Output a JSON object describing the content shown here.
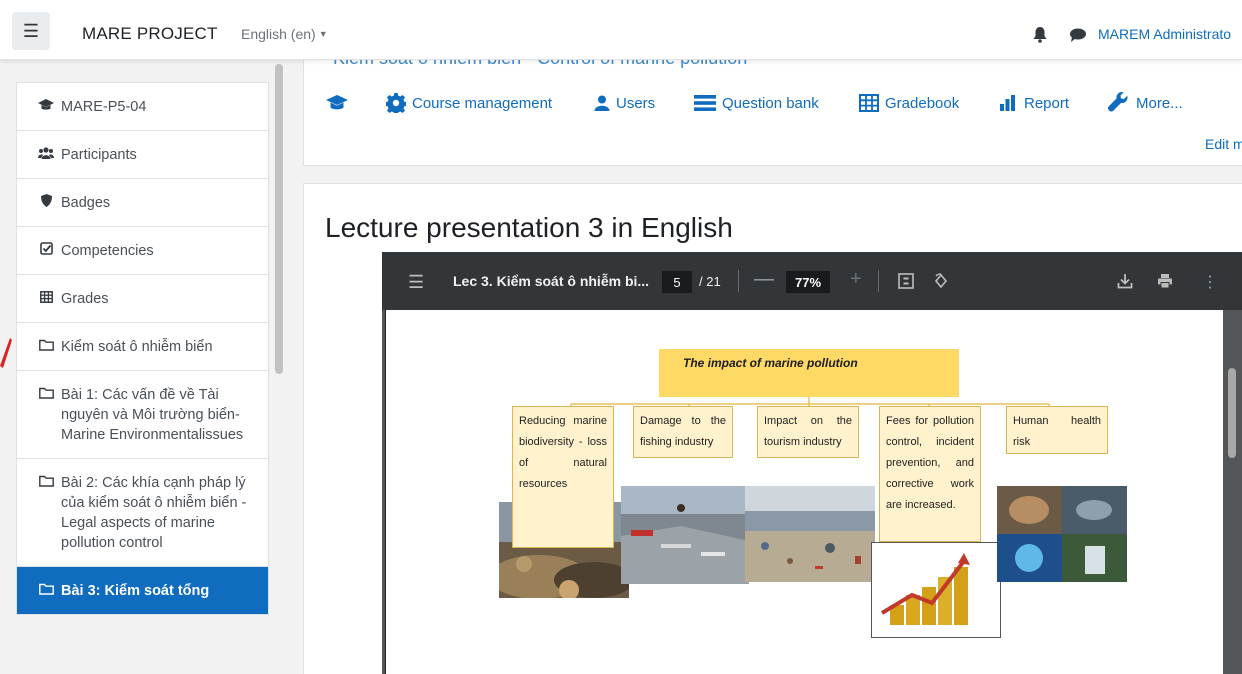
{
  "navbar": {
    "site_name": "MARE PROJECT",
    "language": "English (en)",
    "user_name": "MAREM Administrato"
  },
  "sidebar": {
    "items": [
      {
        "label": "MARE-P5-04",
        "icon": "graduation-cap-icon"
      },
      {
        "label": "Participants",
        "icon": "users-icon"
      },
      {
        "label": "Badges",
        "icon": "shield-icon"
      },
      {
        "label": "Competencies",
        "icon": "check-square-icon"
      },
      {
        "label": "Grades",
        "icon": "table-icon"
      },
      {
        "label": "Kiểm soát ô nhiễm biển",
        "icon": "folder-icon"
      },
      {
        "label": "Bài 1: Các vấn đề về Tài nguyên và Môi trường biển- Marine Environmentalissues",
        "icon": "folder-icon"
      },
      {
        "label": "Bài 2: Các khía cạnh pháp lý của kiểm soát ô nhiễm biển -Legal aspects of marine pollution control",
        "icon": "folder-icon"
      },
      {
        "label": "Bài 3: Kiểm soát tổng",
        "icon": "folder-icon"
      }
    ]
  },
  "course": {
    "title": "Kiểm soát ô nhiễm biển - Control of marine pollution",
    "nav": {
      "course_management": "Course management",
      "users": "Users",
      "question_bank": "Question bank",
      "gradebook": "Gradebook",
      "report": "Report",
      "more": "More..."
    },
    "edit_mode": "Edit m"
  },
  "lecture": {
    "title": "Lecture presentation 3 in English"
  },
  "pdf": {
    "doc_title": "Lec 3. Kiểm soát ô nhiễm bi...",
    "page": "5",
    "page_total": "/ 21",
    "zoom": "77%"
  },
  "slide": {
    "title": "The impact of marine pollution",
    "boxes": [
      "Reducing marine biodiversity - loss of natural resources",
      "Damage to the fishing industry",
      "Impact on the tourism industry",
      "Fees for pollution control, incident prevention, and corrective work are increased.",
      "Human health risk"
    ]
  },
  "colors": {
    "brand": "#0f6cbf",
    "active_bg": "#0f6cbf",
    "pdf_toolbar": "#323639",
    "slide_title_bg": "#ffd966",
    "slide_box_bg": "#fff2cc"
  }
}
